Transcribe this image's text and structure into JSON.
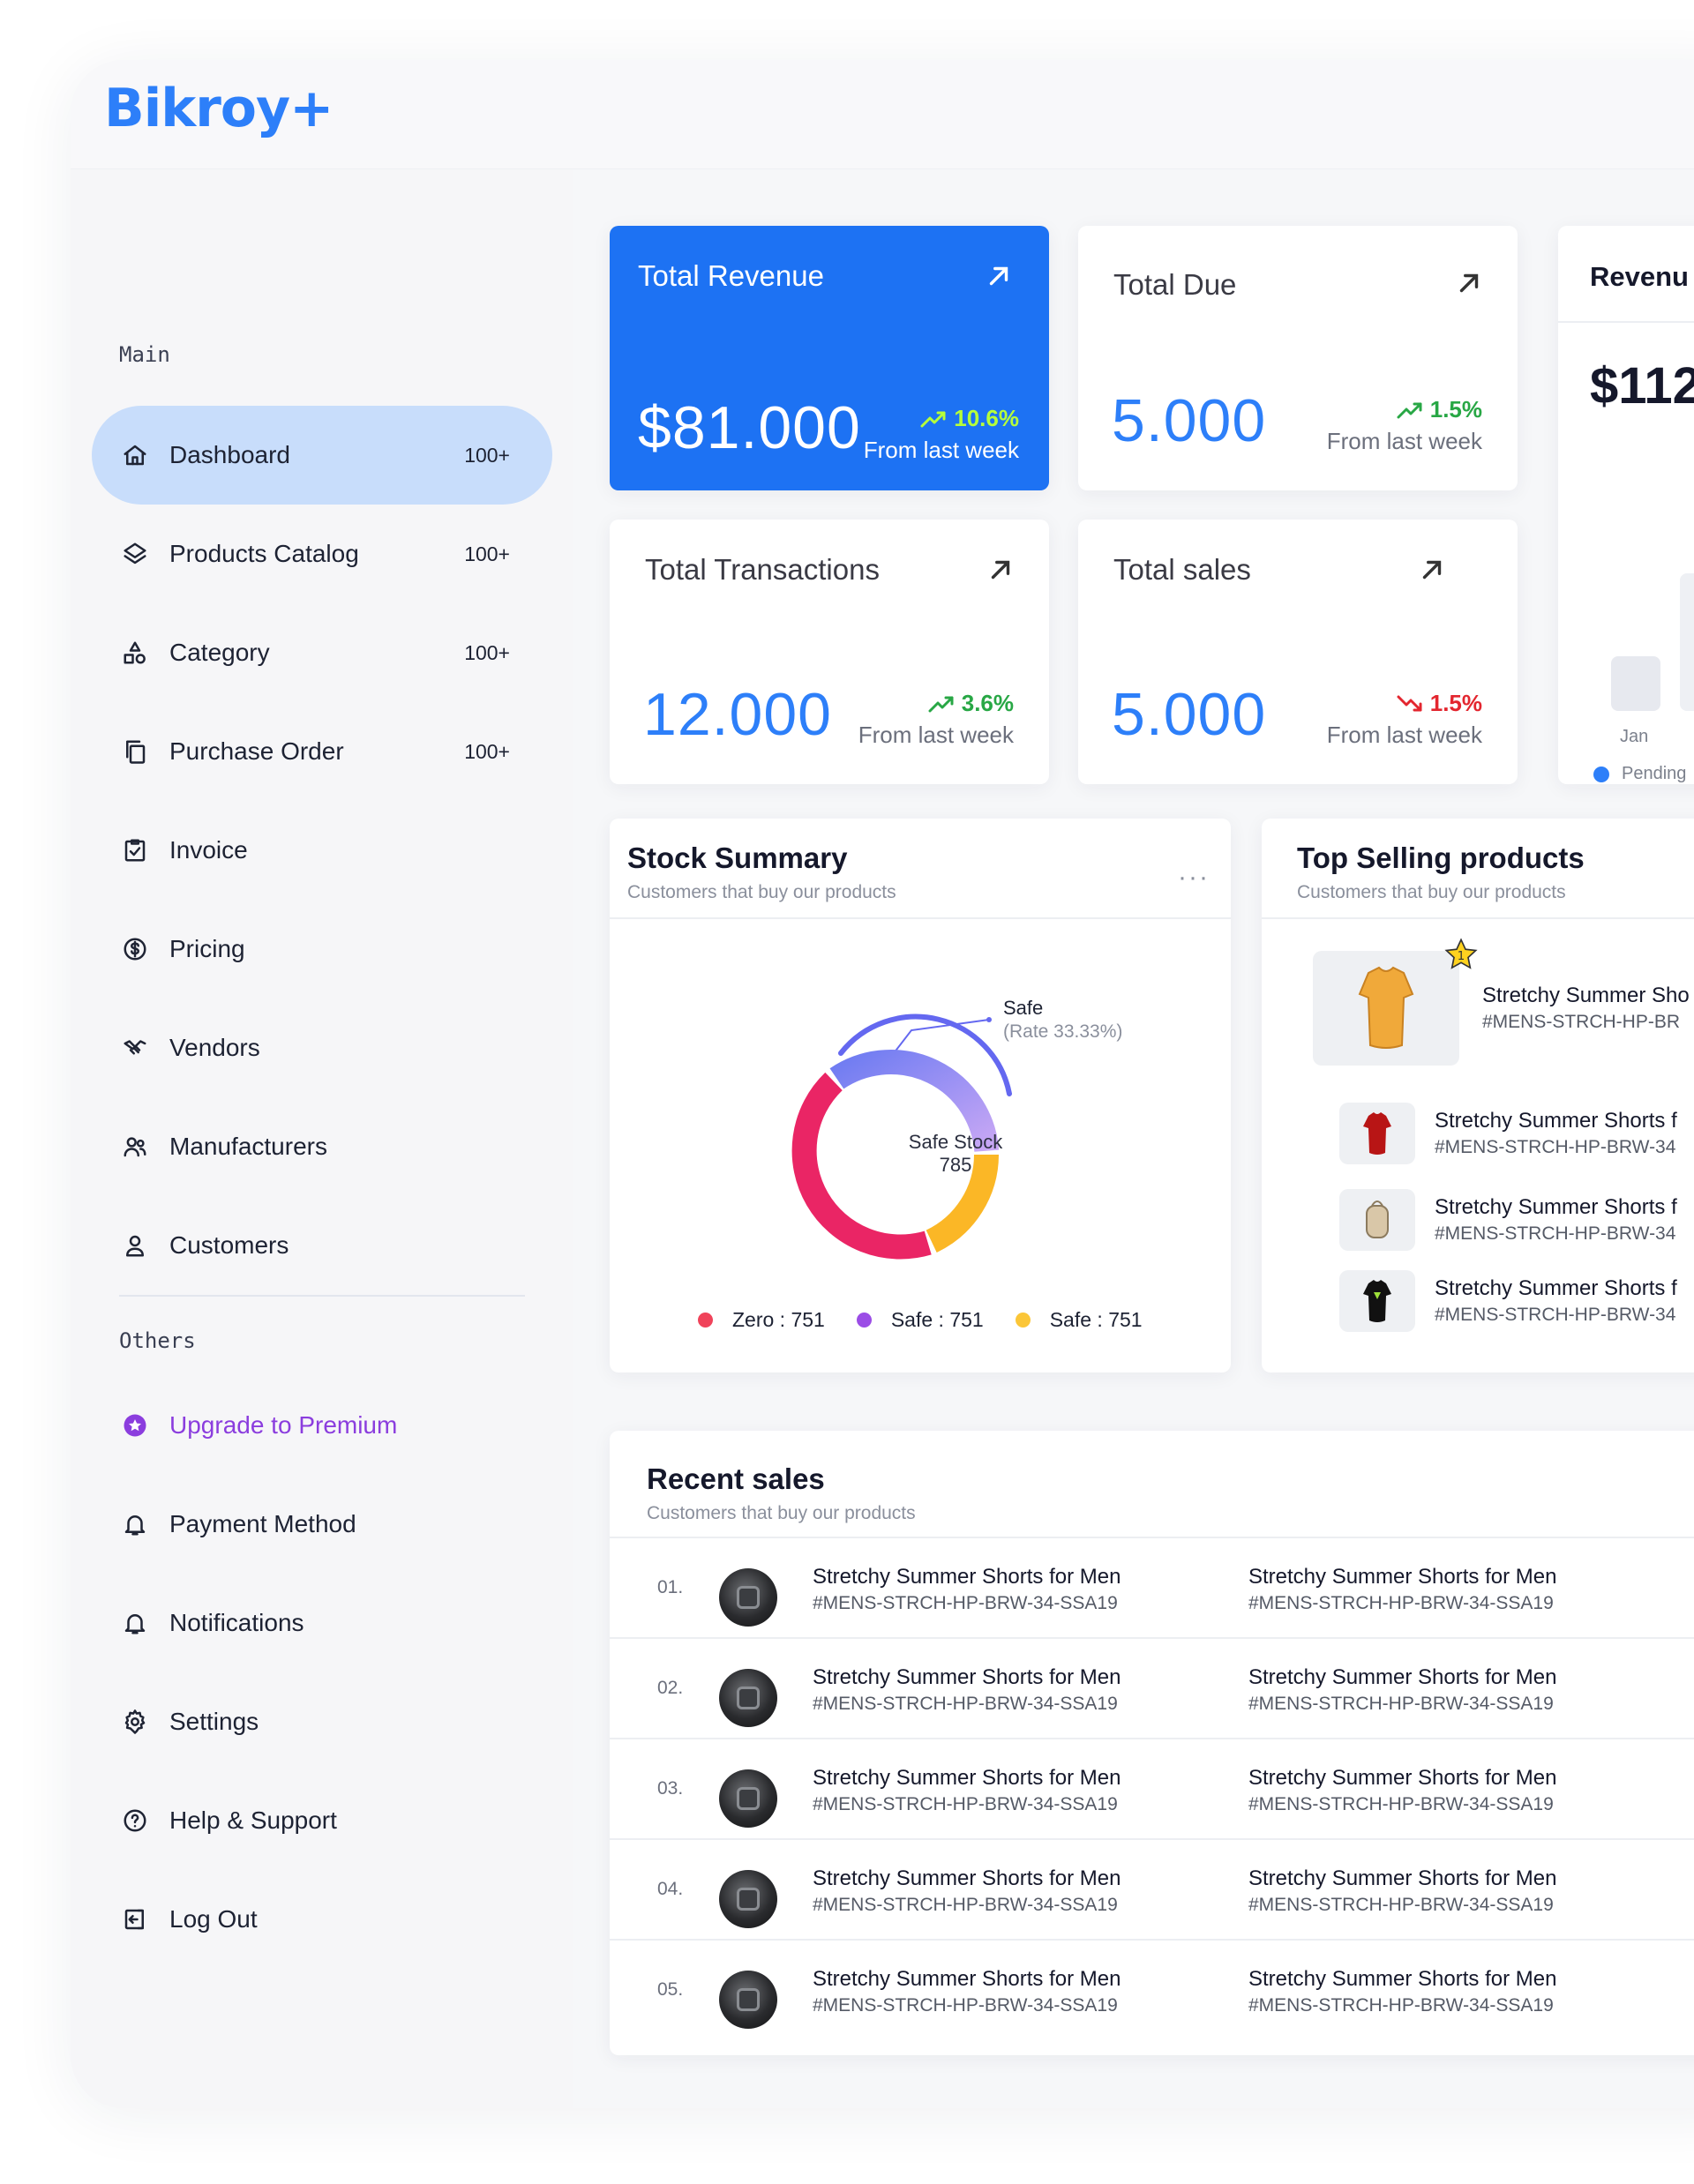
{
  "app": {
    "logo": "Bikroy+"
  },
  "sidebar": {
    "main_label": "Main",
    "others_label": "Others",
    "main_items": [
      {
        "label": "Dashboard",
        "count": "100+",
        "icon": "home-icon"
      },
      {
        "label": "Products Catalog",
        "count": "100+",
        "icon": "layers-icon"
      },
      {
        "label": "Category",
        "count": "100+",
        "icon": "shapes-icon"
      },
      {
        "label": "Purchase Order",
        "count": "100+",
        "icon": "copy-icon"
      },
      {
        "label": "Invoice",
        "icon": "clipboard-check-icon"
      },
      {
        "label": "Pricing",
        "icon": "dollar-circle-icon"
      },
      {
        "label": "Vendors",
        "icon": "handshake-icon"
      },
      {
        "label": "Manufacturers",
        "icon": "users-icon"
      },
      {
        "label": "Customers",
        "icon": "user-icon"
      }
    ],
    "other_items": [
      {
        "label": "Upgrade to Premium",
        "icon": "star-badge-icon"
      },
      {
        "label": "Payment Method",
        "icon": "bell-icon"
      },
      {
        "label": "Notifications",
        "icon": "bell-icon"
      },
      {
        "label": "Settings",
        "icon": "gear-icon"
      },
      {
        "label": "Help & Support",
        "icon": "help-circle-icon"
      },
      {
        "label": "Log Out",
        "icon": "logout-icon"
      }
    ]
  },
  "stats": {
    "revenue": {
      "title": "Total Revenue",
      "value": "$81.000",
      "change": "10.6%",
      "sub": "From last week"
    },
    "due": {
      "title": "Total Due",
      "value": "5.000",
      "change": "1.5%",
      "sub": "From last week"
    },
    "transactions": {
      "title": "Total Transactions",
      "value": "12.000",
      "change": "3.6%",
      "sub": "From last week"
    },
    "sales": {
      "title": "Total sales",
      "value": "5.000",
      "change": "1.5%",
      "sub": "From last week"
    }
  },
  "revenue_panel": {
    "title": "Revenu",
    "value": "$112",
    "month": "Jan",
    "legend": "Pending"
  },
  "stock": {
    "title": "Stock Summary",
    "subtitle": "Customers that buy our products",
    "center_label": "Safe Stock",
    "center_value": "785",
    "callout_label": "Safe",
    "callout_rate": "(Rate 33.33%)",
    "legend": [
      {
        "label": "Zero : 751",
        "color": "#f0435a"
      },
      {
        "label": "Safe : 751",
        "color": "#9b4de6"
      },
      {
        "label": "Safe : 751",
        "color": "#fbc638"
      }
    ],
    "colors": {
      "red": "#ea2565",
      "purple": "#8473f2",
      "yellow": "#fbb726"
    }
  },
  "top_selling": {
    "title": "Top Selling products",
    "subtitle": "Customers that buy our products",
    "badge": "1",
    "items": [
      {
        "name": "Stretchy Summer Sho",
        "sku": "#MENS-STRCH-HP-BR"
      },
      {
        "name": "Stretchy Summer Shorts f",
        "sku": "#MENS-STRCH-HP-BRW-34"
      },
      {
        "name": "Stretchy Summer Shorts f",
        "sku": "#MENS-STRCH-HP-BRW-34"
      },
      {
        "name": "Stretchy Summer Shorts f",
        "sku": "#MENS-STRCH-HP-BRW-34"
      }
    ]
  },
  "recent_sales": {
    "title": "Recent sales",
    "subtitle": "Customers that buy our products",
    "rows": [
      {
        "num": "01.",
        "name": "Stretchy Summer Shorts for Men",
        "sku": "#MENS-STRCH-HP-BRW-34-SSA19",
        "name2": "Stretchy Summer Shorts for Men",
        "sku2": "#MENS-STRCH-HP-BRW-34-SSA19"
      },
      {
        "num": "02.",
        "name": "Stretchy Summer Shorts for Men",
        "sku": "#MENS-STRCH-HP-BRW-34-SSA19",
        "name2": "Stretchy Summer Shorts for Men",
        "sku2": "#MENS-STRCH-HP-BRW-34-SSA19"
      },
      {
        "num": "03.",
        "name": "Stretchy Summer Shorts for Men",
        "sku": "#MENS-STRCH-HP-BRW-34-SSA19",
        "name2": "Stretchy Summer Shorts for Men",
        "sku2": "#MENS-STRCH-HP-BRW-34-SSA19"
      },
      {
        "num": "04.",
        "name": "Stretchy Summer Shorts for Men",
        "sku": "#MENS-STRCH-HP-BRW-34-SSA19",
        "name2": "Stretchy Summer Shorts for Men",
        "sku2": "#MENS-STRCH-HP-BRW-34-SSA19"
      },
      {
        "num": "05.",
        "name": "Stretchy Summer Shorts for Men",
        "sku": "#MENS-STRCH-HP-BRW-34-SSA19",
        "name2": "Stretchy Summer Shorts for Men",
        "sku2": "#MENS-STRCH-HP-BRW-34-SSA19"
      }
    ]
  }
}
